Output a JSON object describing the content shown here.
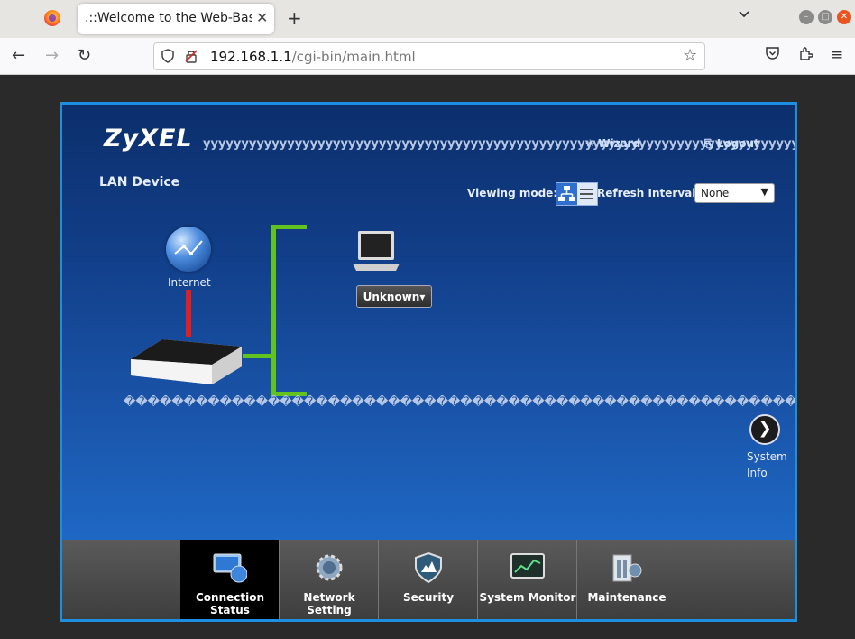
{
  "browser": {
    "tab_title": ".::Welcome to the Web-Based Configurator::.",
    "tab_close": "✕",
    "new_tab": "+",
    "tab_list": "⌄",
    "url_host": "192.168.1.1",
    "url_path": "/cgi-bin/main.html"
  },
  "router": {
    "brand": "ZyXEL",
    "header_garble": "yyyyyyyyyyyyyyyyyyyyyyyyyyyyyyyyyyyyyyyyyyyyyyyyyyyyyyyyyyyyyyyyyyyyyyyyyyyyyyyyyyyyyyyyyyyyyyyy",
    "wizard_label": "Wizard",
    "logout_label": "Logout",
    "section_title": "LAN Device",
    "viewing_mode_label": "Viewing mode:",
    "refresh_interval_label": "Refresh Interval:",
    "refresh_interval_value": "None",
    "internet_label": "Internet",
    "device_button": "Unknown▾",
    "footer_garble": "�������������������������������������������������������������������",
    "system_info_label": "System\nInfo"
  },
  "menu": [
    {
      "label": "Connection Status",
      "icon": "connection-status-icon",
      "active": true
    },
    {
      "label": "Network Setting",
      "icon": "gear-icon",
      "active": false
    },
    {
      "label": "Security",
      "icon": "shield-icon",
      "active": false
    },
    {
      "label": "System Monitor",
      "icon": "monitor-chart-icon",
      "active": false
    },
    {
      "label": "Maintenance",
      "icon": "maintenance-icon",
      "active": false
    }
  ],
  "colors": {
    "frame_border": "#1e8fe0",
    "wan_line": "#e02020",
    "lan_line": "#62c21e",
    "accent_ubuntu": "#e95420"
  }
}
